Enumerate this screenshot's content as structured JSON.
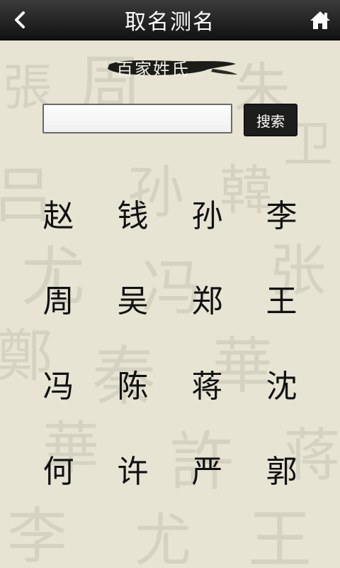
{
  "header": {
    "title": "取名测名",
    "back_icon": "chevron-left-icon",
    "home_icon": "home-icon"
  },
  "banner": {
    "text": "百家姓氏"
  },
  "search": {
    "value": "",
    "placeholder": "",
    "button_label": "搜索"
  },
  "surnames": [
    "赵",
    "钱",
    "孙",
    "李",
    "周",
    "吴",
    "郑",
    "王",
    "冯",
    "陈",
    "蒋",
    "沈",
    "何",
    "许",
    "严",
    "郭"
  ],
  "colors": {
    "header_bg": "#1a1a1a",
    "background": "#e7e4d4",
    "button_bg": "#1d1d1b",
    "text": "#111111"
  }
}
